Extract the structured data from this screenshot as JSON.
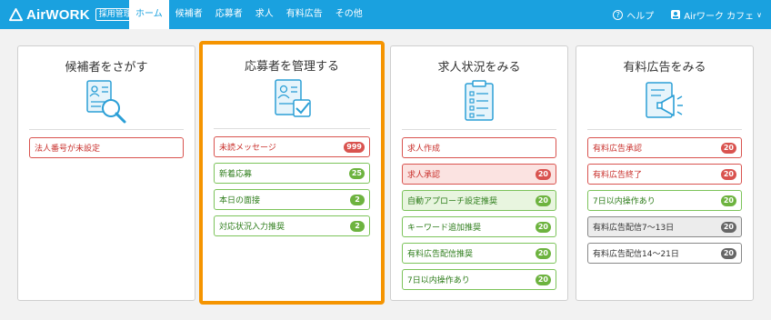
{
  "header": {
    "logo_text": "AirWORK",
    "logo_badge": "採用管理",
    "tabs": [
      {
        "label": "ホーム",
        "active": true
      },
      {
        "label": "候補者",
        "active": false
      },
      {
        "label": "応募者",
        "active": false
      },
      {
        "label": "求人",
        "active": false
      },
      {
        "label": "有料広告",
        "active": false
      },
      {
        "label": "その他",
        "active": false
      }
    ],
    "help_label": "ヘルプ",
    "account_label": "Airワーク カフェ"
  },
  "colors": {
    "brand": "#1aa1df",
    "highlight": "#f59400",
    "alert_red": "#d9534f",
    "ok_green": "#6db33f"
  },
  "cards": [
    {
      "title": "候補者をさがす",
      "icon": "candidate-search-icon",
      "items": [
        {
          "label": "法人番号が未設定",
          "style": "red"
        }
      ]
    },
    {
      "title": "応募者を管理する",
      "icon": "applicant-manage-icon",
      "highlighted": true,
      "items": [
        {
          "label": "未読メッセージ",
          "count": "999",
          "style": "red"
        },
        {
          "label": "新着応募",
          "count": "25",
          "style": "green"
        },
        {
          "label": "本日の面接",
          "count": "2",
          "style": "green"
        },
        {
          "label": "対応状況入力推奨",
          "count": "2",
          "style": "green"
        }
      ]
    },
    {
      "title": "求人状況をみる",
      "icon": "job-status-icon",
      "items": [
        {
          "label": "求人作成",
          "style": "red"
        },
        {
          "label": "求人承認",
          "count": "20",
          "style": "red-fill"
        },
        {
          "label": "自動アプローチ設定推奨",
          "count": "20",
          "style": "green-fill"
        },
        {
          "label": "キーワード追加推奨",
          "count": "20",
          "style": "green"
        },
        {
          "label": "有料広告配信推奨",
          "count": "20",
          "style": "green"
        },
        {
          "label": "7日以内操作あり",
          "count": "20",
          "style": "green"
        }
      ]
    },
    {
      "title": "有料広告をみる",
      "icon": "paid-ad-icon",
      "items": [
        {
          "label": "有料広告承認",
          "count": "20",
          "style": "red"
        },
        {
          "label": "有料広告終了",
          "count": "20",
          "style": "red"
        },
        {
          "label": "7日以内操作あり",
          "count": "20",
          "style": "green"
        },
        {
          "label": "有料広告配信7〜13日",
          "count": "20",
          "style": "gray-fill"
        },
        {
          "label": "有料広告配信14〜21日",
          "count": "20",
          "style": "gray"
        }
      ]
    }
  ]
}
